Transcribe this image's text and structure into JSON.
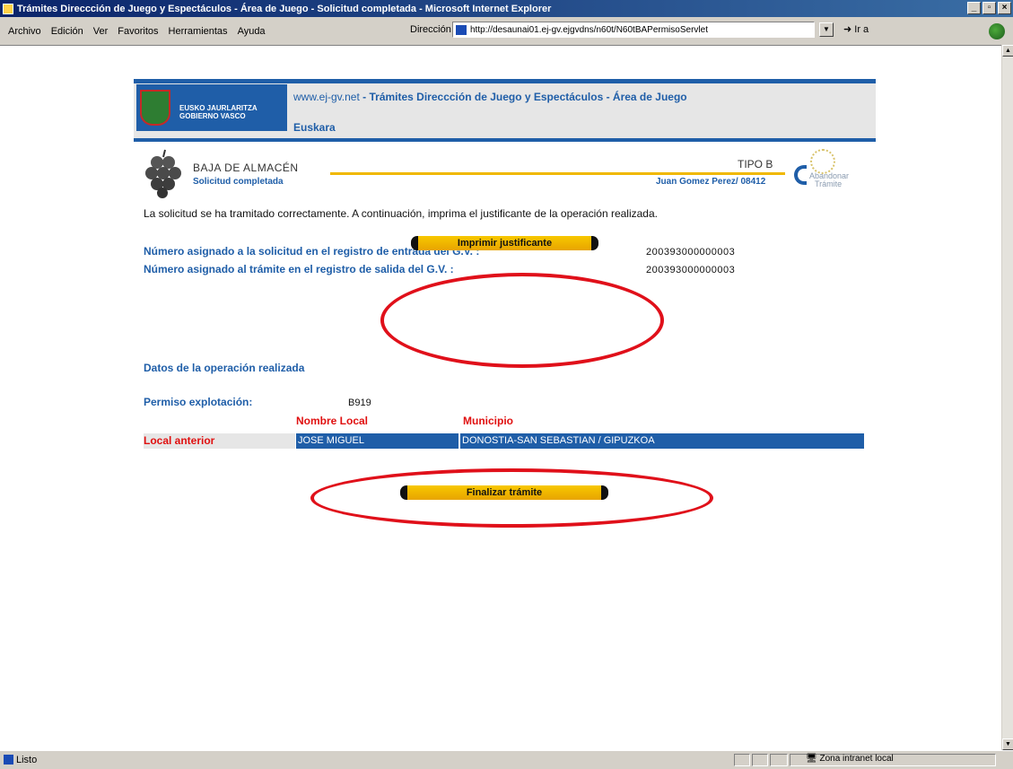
{
  "window": {
    "title": "Trámites Direccción de Juego y Espectáculos - Área de Juego - Solicitud completada - Microsoft Internet Explorer",
    "minimize": "_",
    "maximize": "▫",
    "close": "×"
  },
  "menu": [
    "Archivo",
    "Edición",
    "Ver",
    "Favoritos",
    "Herramientas",
    "Ayuda"
  ],
  "address": {
    "label": "Dirección",
    "url": "http://desaunai01.ej-gv.ejgvdns/n60t/N60tBAPermisoServlet",
    "go": "Ir a"
  },
  "header": {
    "logo_line1": "EUSKO JAURLARITZA",
    "logo_line2": "GOBIERNO VASCO",
    "site_prefix": "www.ej-gv.net",
    "site_title": " - Trámites Direccción de Juego y Espectáculos - Área de Juego",
    "language_link": "Euskara"
  },
  "step": {
    "title": "BAJA DE ALMACÉN",
    "subtitle": "Solicitud completada",
    "tipo": "TIPO B",
    "usuario": "Juan Gomez Perez/ 08412",
    "abandonar_line1": "Abandonar",
    "abandonar_line2": "Trámite"
  },
  "message": "La solicitud se ha tramitado correctamente. A continuación, imprima el justificante de la operación realizada.",
  "registros": [
    {
      "label": "Número asignado a la solicitud en el registro de entrada del G.V. :",
      "value": "200393000000003"
    },
    {
      "label": "Número asignado al trámite en el registro de salida del G.V. :",
      "value": "200393000000003"
    }
  ],
  "buttons": {
    "imprimir": "Imprimir justificante",
    "finalizar": "Finalizar trámite"
  },
  "operacion": {
    "section_title": "Datos de la operación realizada",
    "permiso_label": "Permiso explotación:",
    "permiso_value": "B919",
    "col_nombre": "Nombre Local",
    "col_municipio": "Municipio",
    "row_label": "Local anterior",
    "nombre_local": "JOSE MIGUEL",
    "municipio": "DONOSTIA-SAN SEBASTIAN / GIPUZKOA"
  },
  "status": {
    "text": "Listo",
    "zone": "Zona intranet local"
  },
  "colors": {
    "brand_blue": "#1f5ea8",
    "accent_gold": "#f0b800",
    "annotation_red": "#e0101a"
  }
}
